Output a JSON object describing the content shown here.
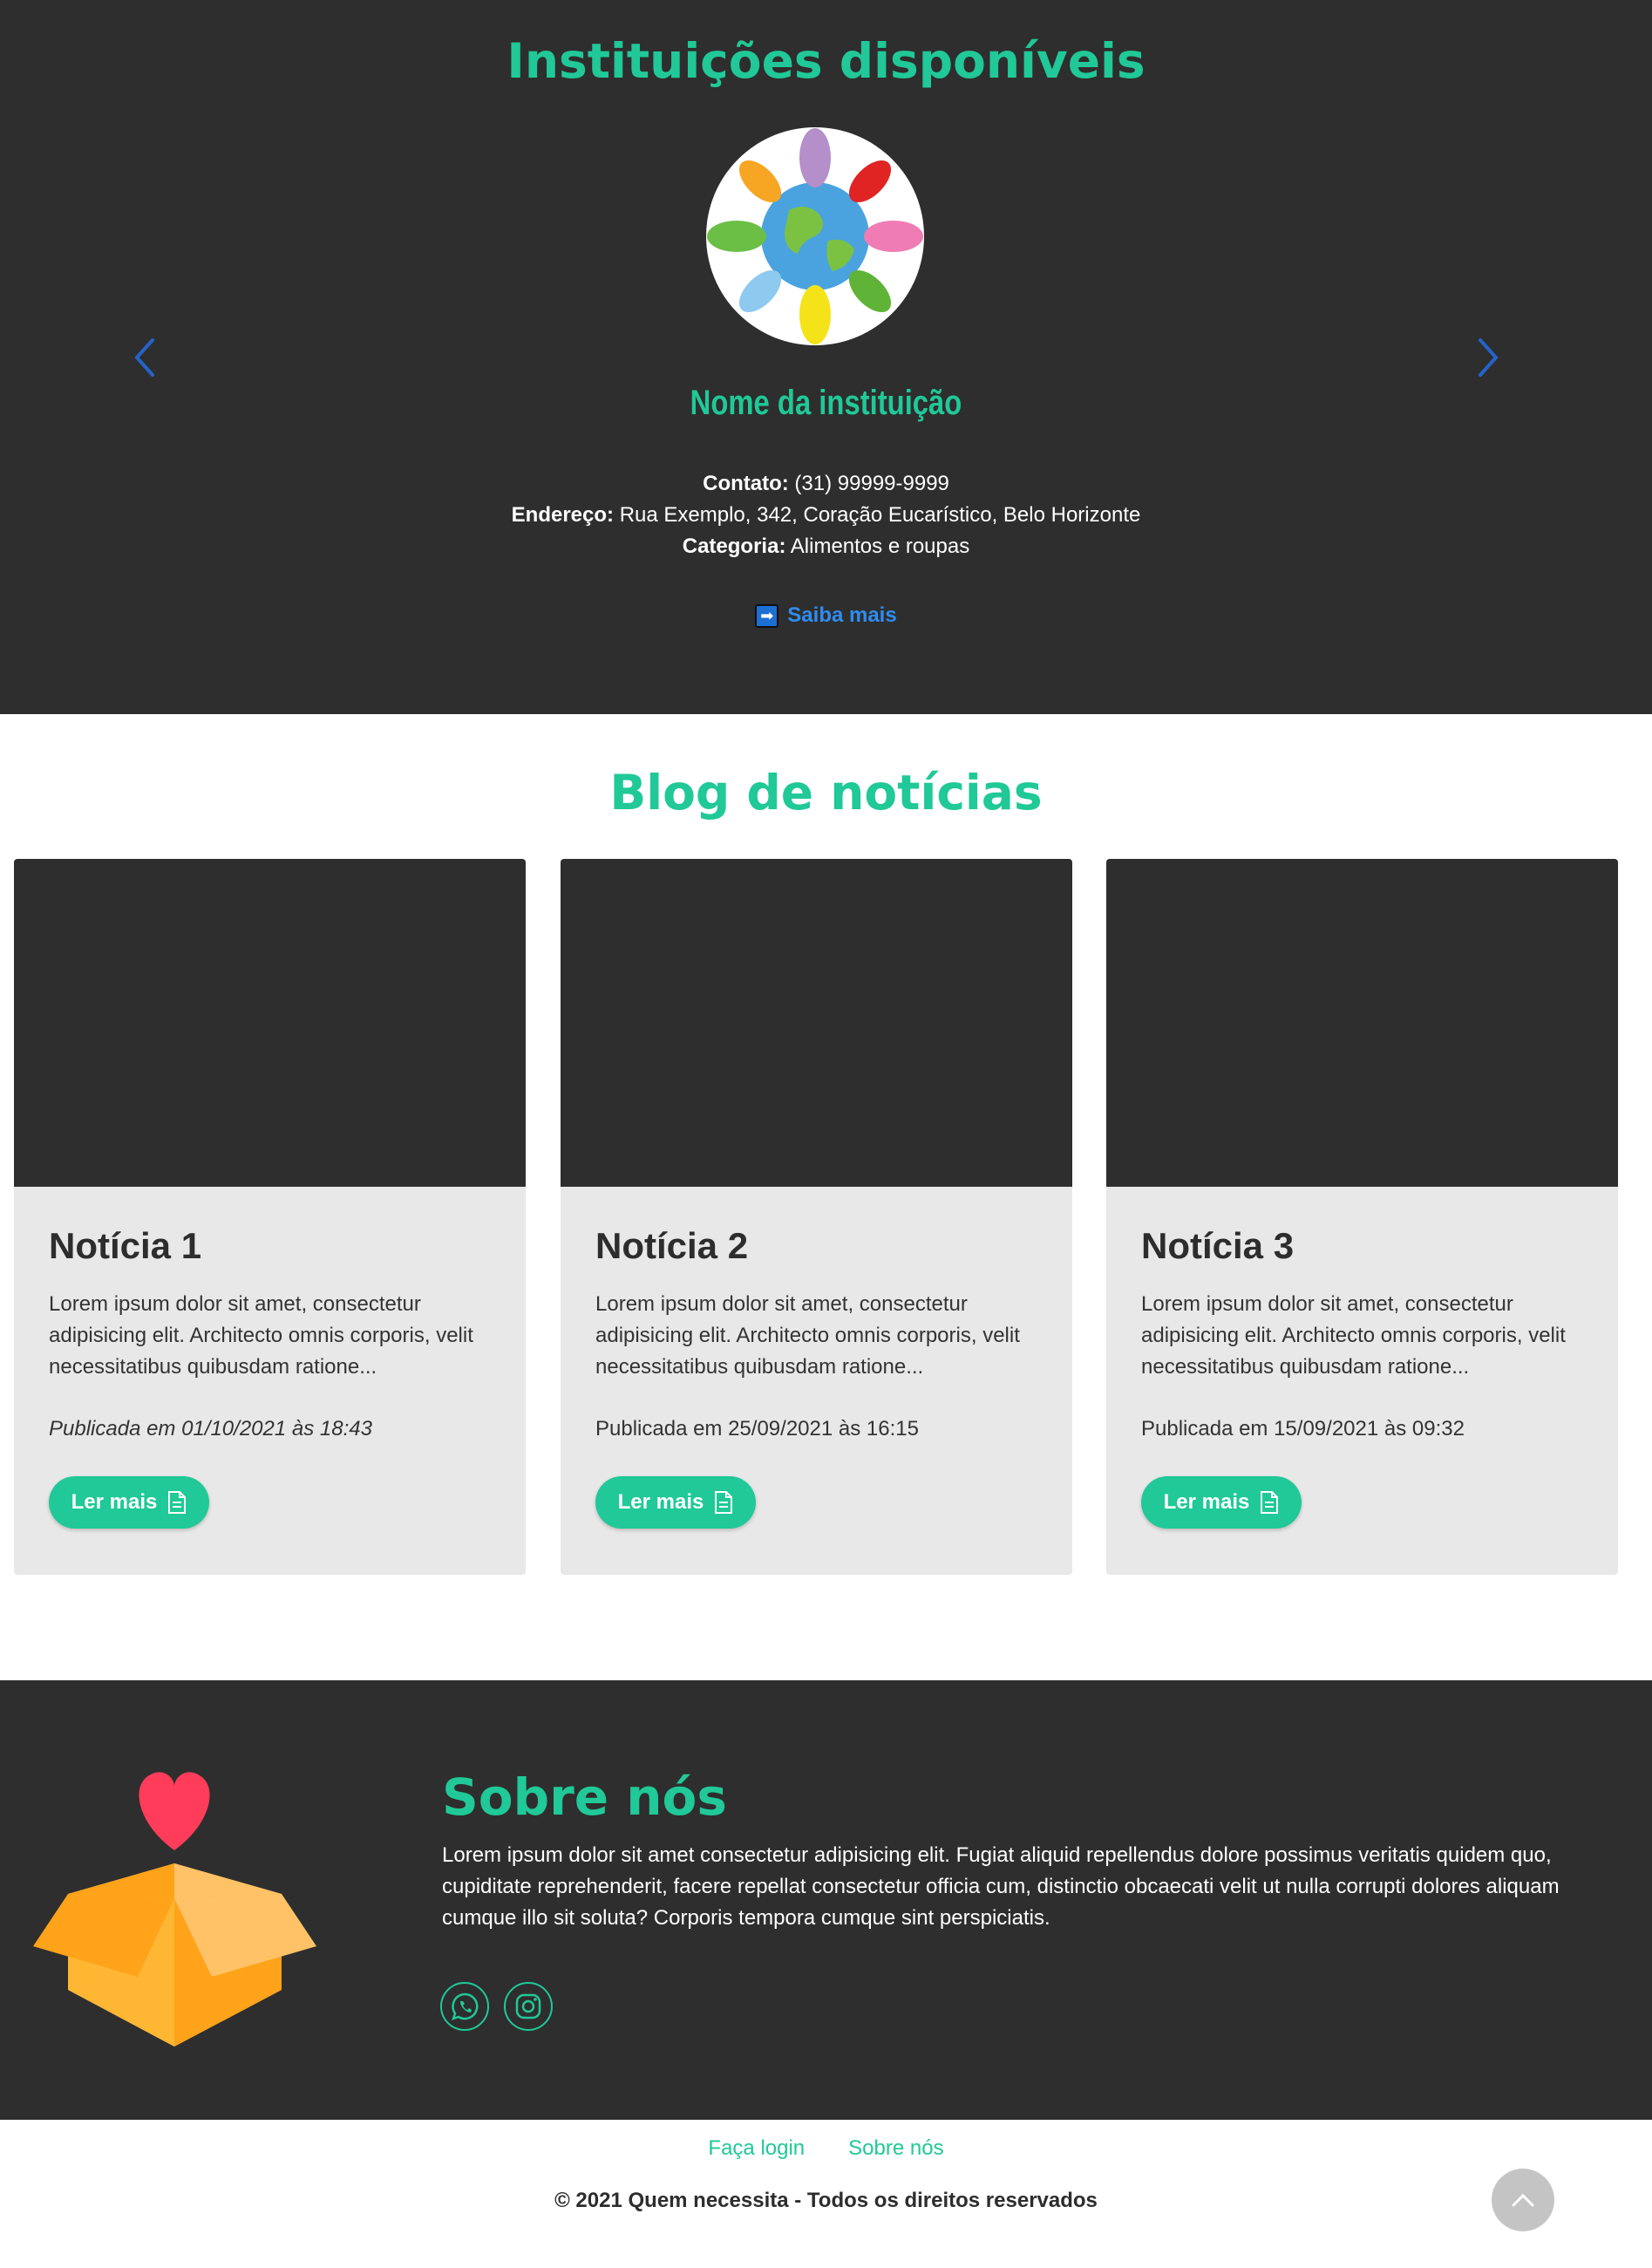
{
  "institutions": {
    "title": "Instituições disponíveis",
    "name": "Nome da instituição",
    "contact_label": "Contato:",
    "contact_value": "(31) 99999-9999",
    "address_label": "Endereço:",
    "address_value": "Rua Exemplo, 342, Coração Eucarístico, Belo Horizonte",
    "category_label": "Categoria:",
    "category_value": "Alimentos e roupas",
    "more_label": "Saiba mais"
  },
  "blog": {
    "title": "Blog de notícias",
    "cards": [
      {
        "title": "Notícia 1",
        "text": "Lorem ipsum dolor sit amet, consectetur adipisicing elit. Architecto omnis corporis, velit necessitatibus quibusdam ratione...",
        "date": "Publicada em 01/10/2021 às 18:43",
        "button": "Ler mais"
      },
      {
        "title": "Notícia 2",
        "text": "Lorem ipsum dolor sit amet, consectetur adipisicing elit. Architecto omnis corporis, velit necessitatibus quibusdam ratione...",
        "date": "Publicada em 25/09/2021 às 16:15",
        "button": "Ler mais"
      },
      {
        "title": "Notícia 3",
        "text": "Lorem ipsum dolor sit amet, consectetur adipisicing elit. Architecto omnis corporis, velit necessitatibus quibusdam ratione...",
        "date": "Publicada em 15/09/2021 às 09:32",
        "button": "Ler mais"
      }
    ]
  },
  "about": {
    "title": "Sobre nós",
    "text": "Lorem ipsum dolor sit amet consectetur adipisicing elit. Fugiat aliquid repellendus dolore possimus veritatis quidem quo, cupiditate reprehenderit, facere repellat consectetur officia cum, distinctio obcaecati velit ut nulla corrupti dolores aliquam cumque illo sit soluta? Corporis tempora cumque sint perspiciatis."
  },
  "footer": {
    "login_link": "Faça login",
    "about_link": "Sobre nós",
    "copyright": "© 2021 Quem necessita - Todos os direitos reservados"
  },
  "icons": {
    "prev": "chevron-left-icon",
    "next": "chevron-right-icon",
    "more": "arrow-right-icon",
    "read": "document-icon",
    "whatsapp": "whatsapp-icon",
    "instagram": "instagram-icon",
    "back_to_top": "chevron-up-icon"
  },
  "colors": {
    "accent": "#20c997",
    "dark": "#2e2e2e",
    "card": "#e8e8e8",
    "link_blue": "#2f8cf0"
  }
}
